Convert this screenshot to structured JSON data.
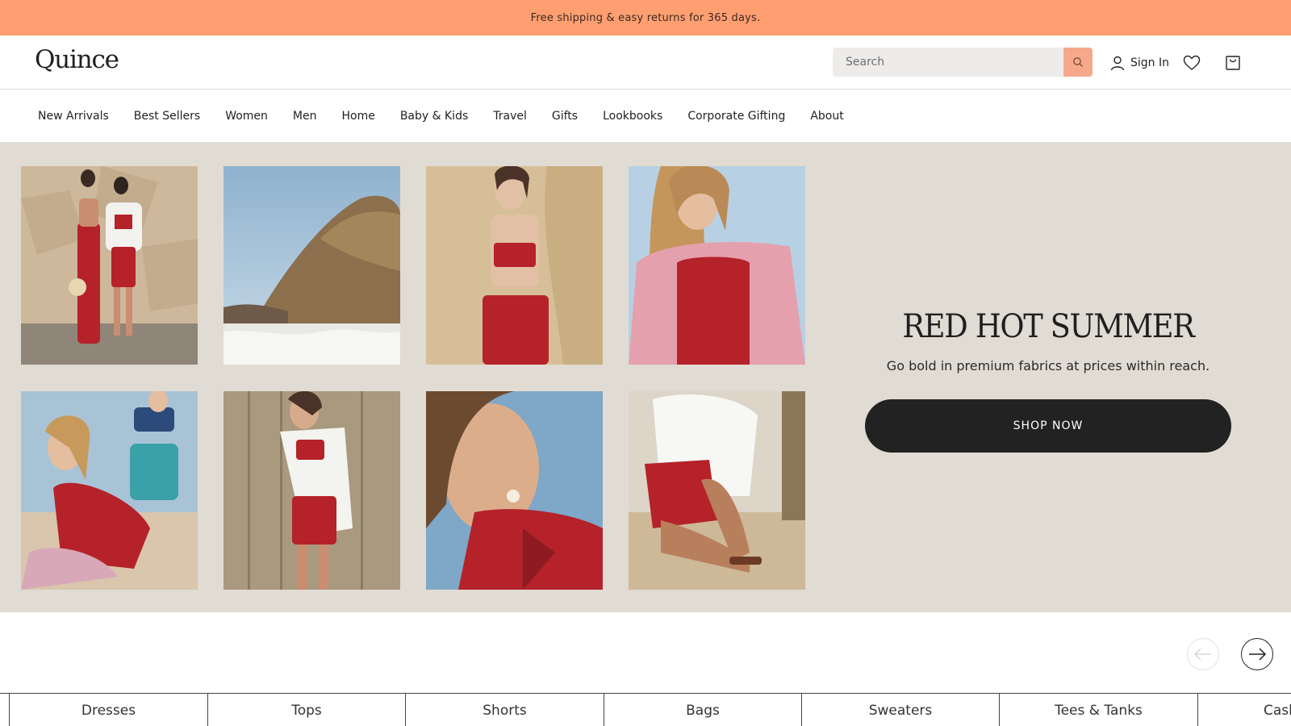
{
  "promo": {
    "text": "Free shipping & easy returns for 365 days."
  },
  "header": {
    "logo": "Quince",
    "search_placeholder": "Search",
    "signin_label": "Sign In"
  },
  "nav": {
    "items": [
      "New Arrivals",
      "Best Sellers",
      "Women",
      "Men",
      "Home",
      "Baby & Kids",
      "Travel",
      "Gifts",
      "Lookbooks",
      "Corporate Gifting",
      "About"
    ]
  },
  "hero": {
    "title": "RED HOT SUMMER",
    "subtitle": "Go bold in premium fabrics at prices within reach.",
    "cta": "SHOP NOW"
  },
  "categories": [
    "Dresses",
    "Tops",
    "Shorts",
    "Bags",
    "Sweaters",
    "Tees & Tanks",
    "Cashmere"
  ],
  "colors": {
    "promo_bg": "#ff9f71",
    "hero_bg": "#e1dcd3",
    "accent_red": "#b5222a",
    "button_dark": "#222222",
    "search_btn": "#f5a98a"
  },
  "icons": [
    "search-icon",
    "user-icon",
    "heart-icon",
    "bag-icon",
    "arrow-left-icon",
    "arrow-right-icon"
  ]
}
